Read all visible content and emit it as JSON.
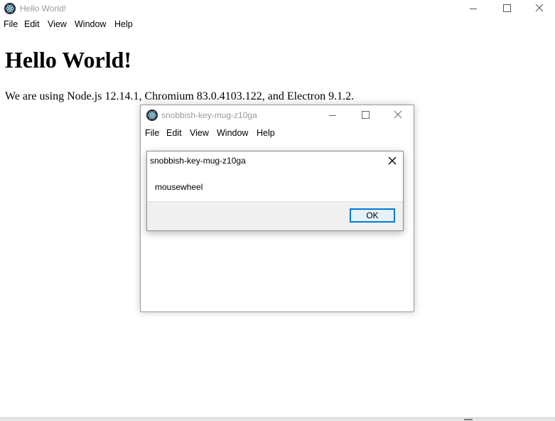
{
  "main_window": {
    "title": "Hello World!",
    "menu": [
      "File",
      "Edit",
      "View",
      "Window",
      "Help"
    ],
    "heading": "Hello World!",
    "body_text": "We are using Node.js 12.14.1, Chromium 83.0.4103.122, and Electron 9.1.2."
  },
  "child_window": {
    "title": "snobbish-key-mug-z10ga",
    "menu": [
      "File",
      "Edit",
      "View",
      "Window",
      "Help"
    ]
  },
  "message_box": {
    "title": "snobbish-key-mug-z10ga",
    "message": "mousewheel",
    "ok_label": "OK"
  },
  "icons": {
    "app": "electron-app-icon",
    "minimize": "minimize-icon",
    "maximize": "maximize-icon",
    "close": "close-icon"
  },
  "colors": {
    "title_text": "#9b9b9b",
    "button_border": "#0078d7",
    "button_fill": "#e5f1fb",
    "dialog_footer": "#f0f0f0"
  }
}
